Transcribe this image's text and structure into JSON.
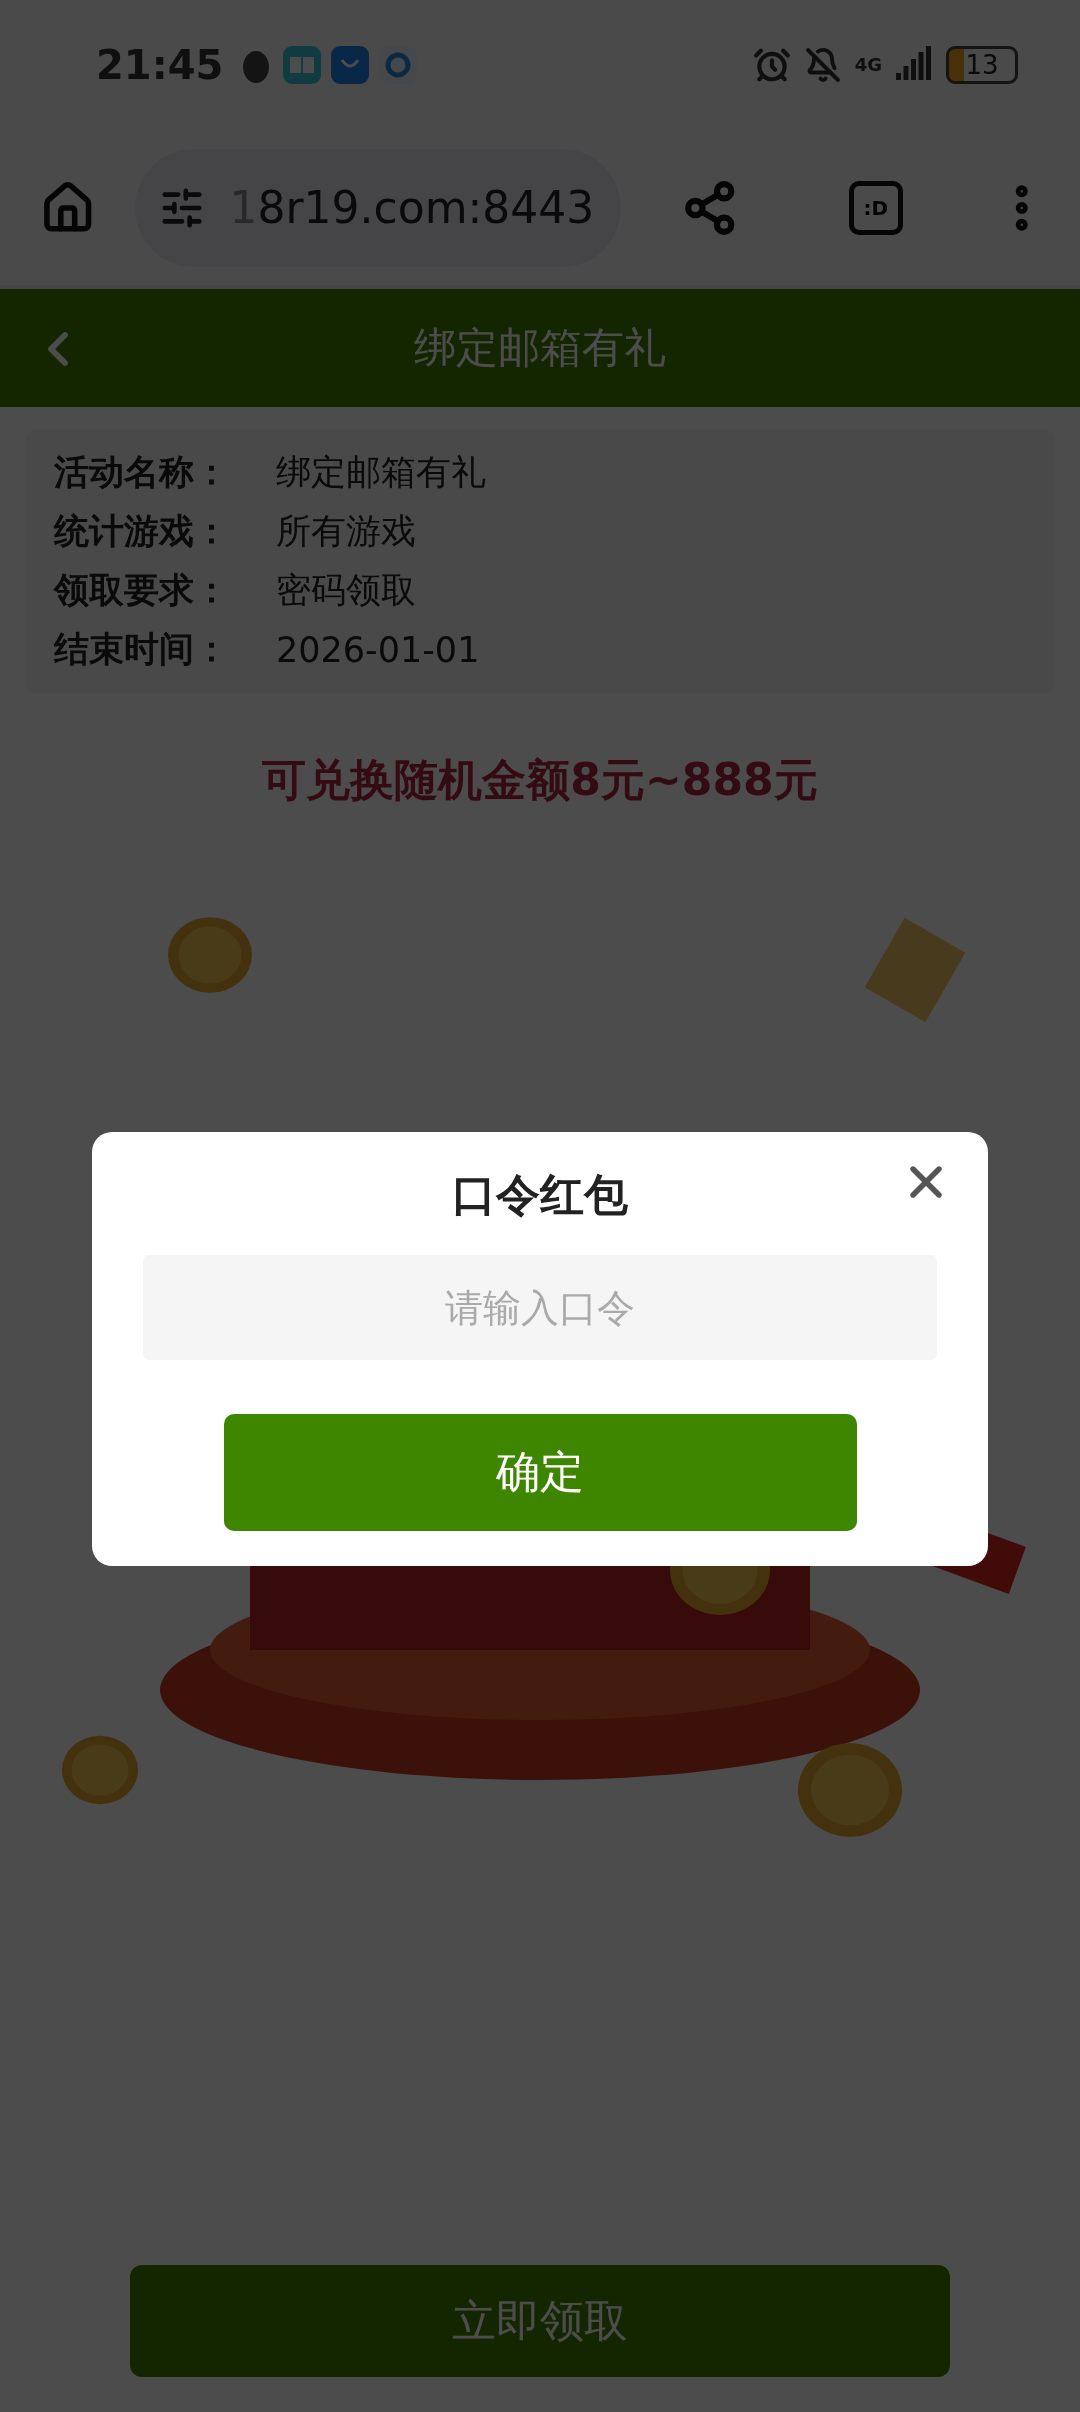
{
  "status_bar": {
    "time": "21:45",
    "network": "4G",
    "battery": "13"
  },
  "browser": {
    "url_faded": "1",
    "url": "8r19.com:8443",
    "tab_icon_label": ":D"
  },
  "header": {
    "title": "绑定邮箱有礼"
  },
  "info": [
    {
      "label": "活动名称：",
      "value": "绑定邮箱有礼"
    },
    {
      "label": "统计游戏：",
      "value": "所有游戏"
    },
    {
      "label": "领取要求：",
      "value": "密码领取"
    },
    {
      "label": "结束时间：",
      "value": "2026-01-01"
    }
  ],
  "prize_text": "可兑换随机金额8元~888元",
  "claim_button": "立即领取",
  "dialog": {
    "title": "口令红包",
    "placeholder": "请输入口令",
    "confirm": "确定"
  }
}
